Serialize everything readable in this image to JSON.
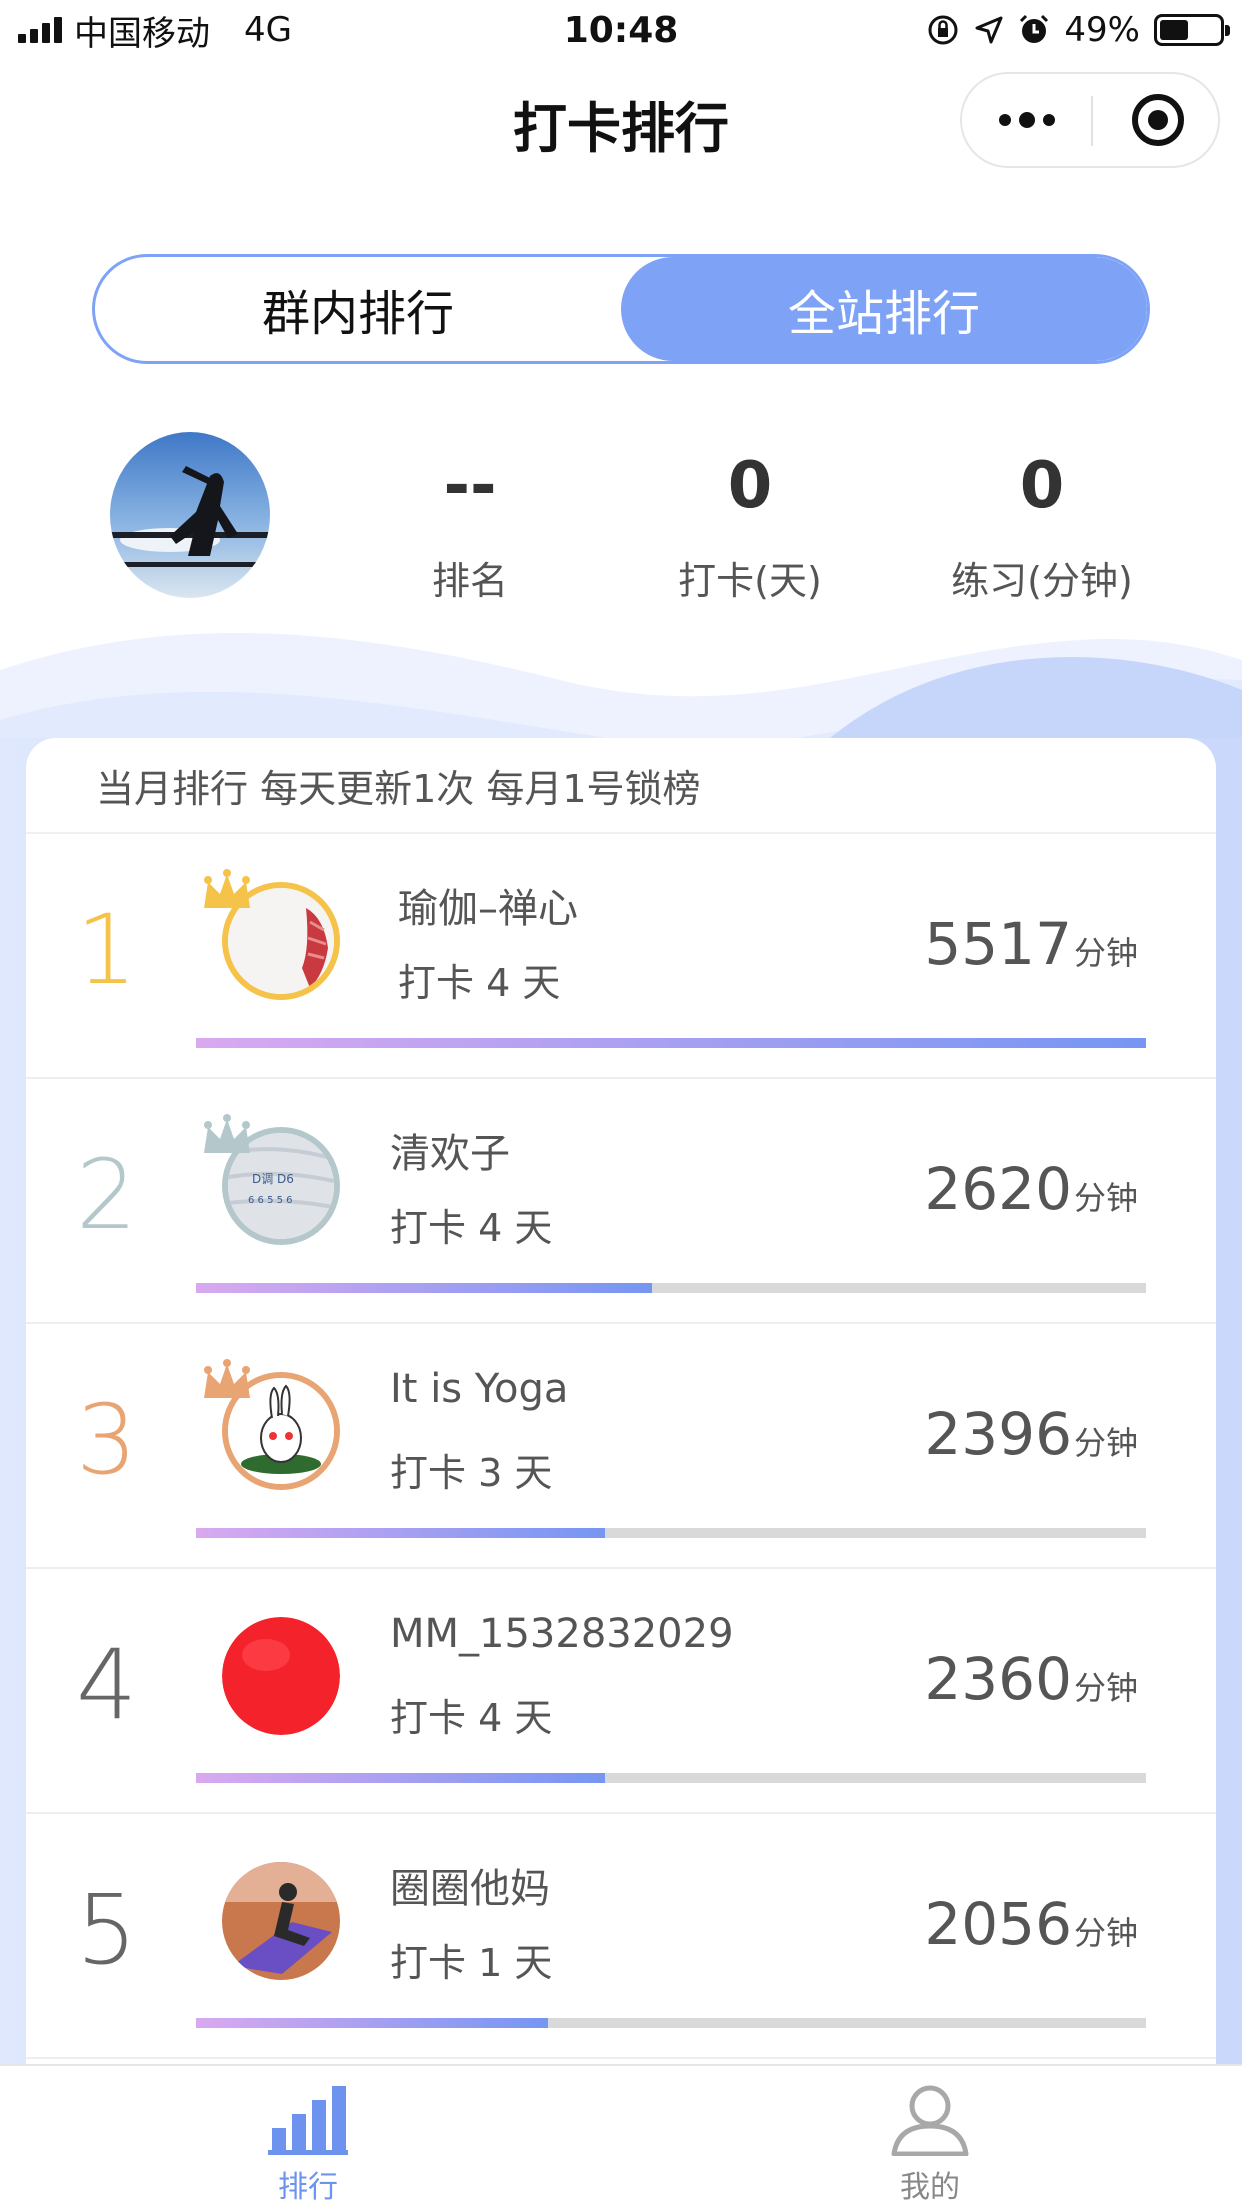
{
  "status_bar": {
    "carrier": "中国移动",
    "network": "4G",
    "time": "10:48",
    "battery": "49%",
    "battery_level": 0.49
  },
  "nav": {
    "title": "打卡排行"
  },
  "segment": {
    "tabs": [
      {
        "label": "群内排行",
        "active": false
      },
      {
        "label": "全站排行",
        "active": true
      }
    ]
  },
  "user_stats": [
    {
      "value": "--",
      "label": "排名"
    },
    {
      "value": "0",
      "label": "打卡(天)"
    },
    {
      "value": "0",
      "label": "练习(分钟)"
    }
  ],
  "ranking": {
    "header": "当月排行 每天更新1次 每月1号锁榜",
    "unit": "分钟",
    "rows": [
      {
        "rank": "1",
        "name": "瑜伽–禅心",
        "days": "打卡 4 天",
        "minutes": "5517",
        "progress": 1.0
      },
      {
        "rank": "2",
        "name": "清欢子",
        "days": "打卡 4 天",
        "minutes": "2620",
        "progress": 0.48
      },
      {
        "rank": "3",
        "name": "It is Yoga",
        "days": "打卡 3 天",
        "minutes": "2396",
        "progress": 0.43
      },
      {
        "rank": "4",
        "name": "MM_1532832029",
        "days": "打卡 4 天",
        "minutes": "2360",
        "progress": 0.43
      },
      {
        "rank": "5",
        "name": "圈圈他妈",
        "days": "打卡 1 天",
        "minutes": "2056",
        "progress": 0.37
      }
    ]
  },
  "tabbar": {
    "items": [
      {
        "label": "排行",
        "icon": "bar-chart-icon",
        "active": true
      },
      {
        "label": "我的",
        "icon": "person-icon",
        "active": false
      }
    ]
  },
  "colors": {
    "accent": "#7ea3f6",
    "gold": "#f5c24a",
    "silver": "#b4c8cc",
    "bronze": "#e8a472"
  }
}
